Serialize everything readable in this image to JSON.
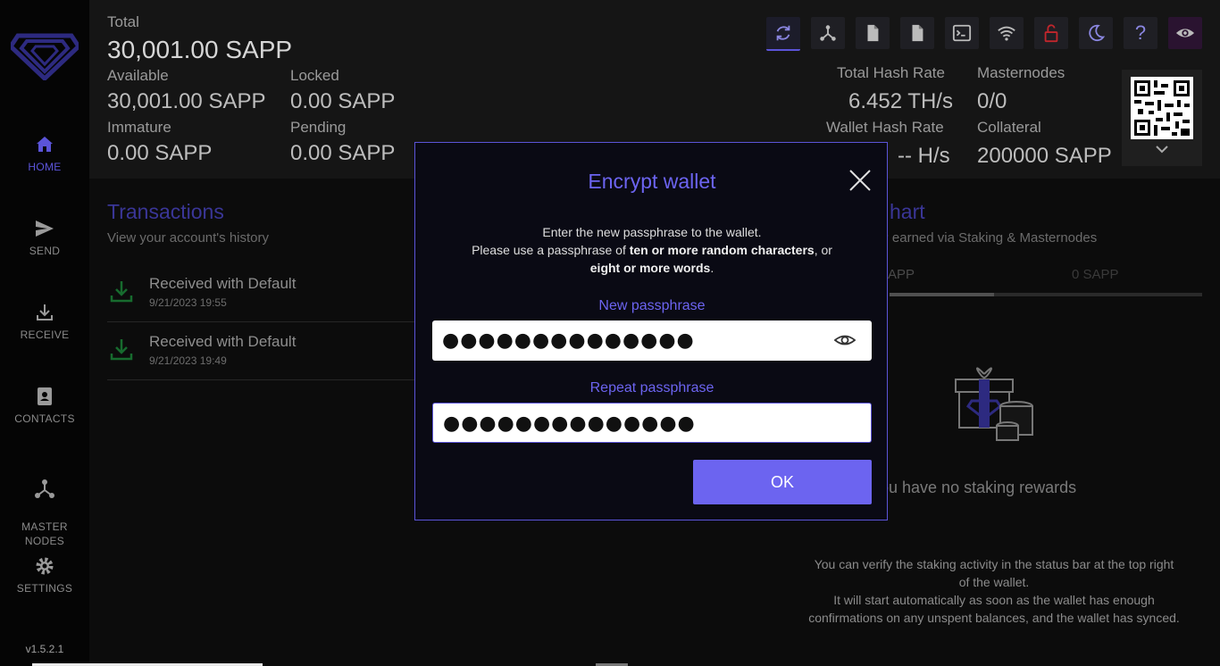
{
  "sidebar": {
    "items": [
      {
        "label": "HOME",
        "icon": "home-icon"
      },
      {
        "label": "SEND",
        "icon": "send-icon"
      },
      {
        "label": "RECEIVE",
        "icon": "receive-icon"
      },
      {
        "label": "CONTACTS",
        "icon": "contacts-icon"
      },
      {
        "label": "MASTER\nNODES",
        "icon": "masternodes-icon"
      },
      {
        "label": "SETTINGS",
        "icon": "gear-icon"
      }
    ],
    "version": "v1.5.2.1"
  },
  "balances": {
    "total_label": "Total",
    "total_value": "30,001.00 SAPP",
    "available_label": "Available",
    "available_value": "30,001.00 SAPP",
    "locked_label": "Locked",
    "locked_value": "0.00 SAPP",
    "immature_label": "Immature",
    "immature_value": "0.00 SAPP",
    "pending_label": "Pending",
    "pending_value": "0.00 SAPP"
  },
  "stats": {
    "total_hash_label": "Total Hash Rate",
    "total_hash_value": "6.452 TH/s",
    "masternodes_label": "Masternodes",
    "masternodes_value": "0/0",
    "wallet_hash_label": "Wallet Hash Rate",
    "wallet_hash_value": "-- H/s",
    "collateral_label": "Collateral",
    "collateral_value": "200000 SAPP"
  },
  "toolbar": {
    "icons": [
      "sync-icon",
      "masternodes-icon",
      "document-icon",
      "document-icon",
      "terminal-icon",
      "wifi-icon",
      "lock-icon",
      "moon-icon",
      "help-icon",
      "eye-icon"
    ],
    "help_label": "?"
  },
  "transactions": {
    "title": "Transactions",
    "subtitle": "View your account's history",
    "rows": [
      {
        "label": "Received with Default",
        "date": "9/21/2023 19:55"
      },
      {
        "label": "Received with Default",
        "date": "9/21/2023 19:49"
      }
    ]
  },
  "chart": {
    "title": "hart",
    "subtitle": "P earned via Staking & Masternodes",
    "tab1": "APP",
    "tab2": "0 SAPP",
    "empty_text": "ou have no staking rewards",
    "help_text_1": "You can verify the staking activity in the status bar at the top right of the wallet.",
    "help_text_2": "It will start automatically as soon as the wallet has enough confirmations on any unspent balances, and the wallet has synced."
  },
  "modal": {
    "title": "Encrypt wallet",
    "desc_line1": "Enter the new passphrase to the wallet.",
    "desc_pre": "Please use a passphrase of ",
    "desc_bold1": "ten or more random characters",
    "desc_mid": ", or ",
    "desc_bold2": "eight or more words",
    "desc_end": ".",
    "new_label": "New passphrase",
    "new_value": "●●●●●●●●●●●●●●",
    "repeat_label": "Repeat passphrase",
    "repeat_value": "●●●●●●●●●●●●●●",
    "ok_label": "OK"
  },
  "colors": {
    "accent": "#6c64f0",
    "header_bg": "#151515",
    "sidebar_bg": "#050505"
  }
}
